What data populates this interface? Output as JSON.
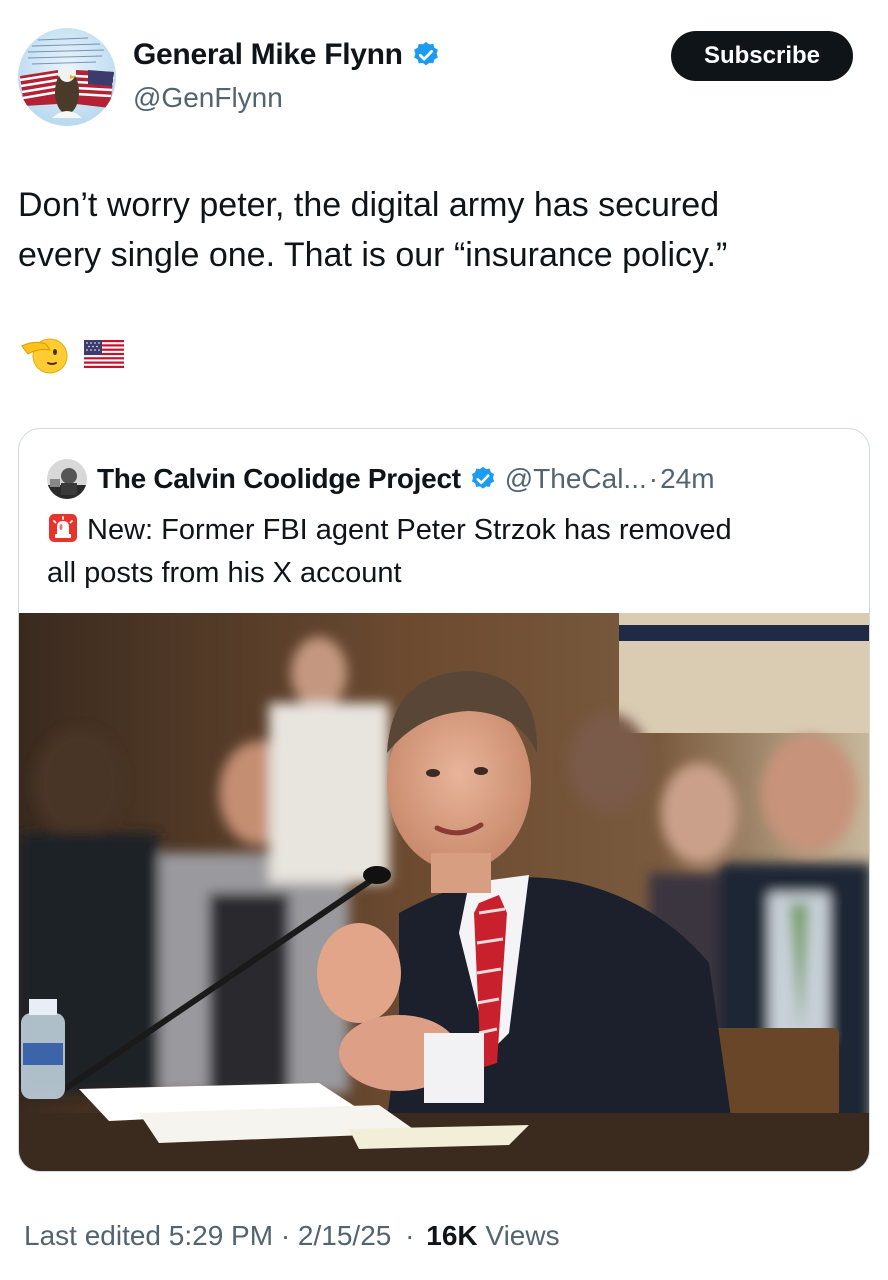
{
  "author": {
    "name": "General Mike Flynn",
    "handle": "@GenFlynn",
    "verified_color": "#1d9bf0"
  },
  "subscribe_label": "Subscribe",
  "tweet": {
    "line1": "Don’t worry peter, the digital army has secured",
    "line2": "every single one. That is our “insurance policy.”",
    "emojis": [
      "saluting-face",
      "us-flag"
    ]
  },
  "quote": {
    "name": "The Calvin Coolidge Project",
    "handle": "@TheCal...",
    "separator": "·",
    "time": "24m",
    "line1": "New: Former FBI agent Peter Strzok has removed",
    "line2": "all posts from his X account"
  },
  "footer": {
    "edited": "Last edited 5:29 PM · 2/15/25",
    "dot": "·",
    "views_count": "16K",
    "views_label": "Views"
  }
}
